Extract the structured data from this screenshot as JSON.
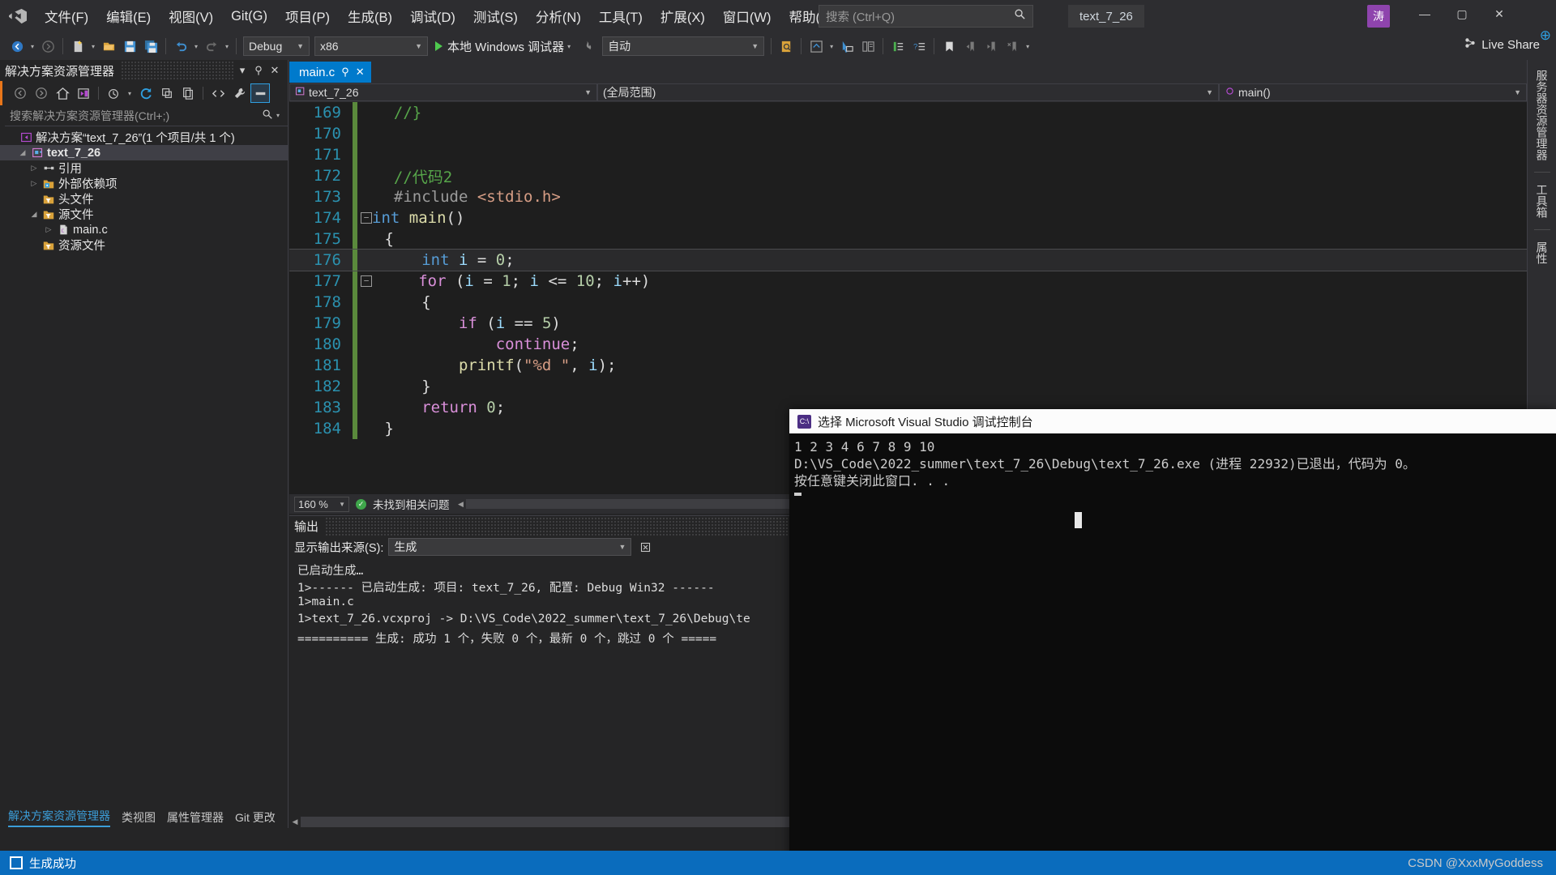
{
  "window": {
    "logo_icon": "visual-studio-logo",
    "project_badge": "text_7_26",
    "avatar_initial": "涛",
    "minimize": "—",
    "maximize": "▢",
    "close": "✕"
  },
  "menu": {
    "items": [
      {
        "label": "文件(F)"
      },
      {
        "label": "编辑(E)"
      },
      {
        "label": "视图(V)"
      },
      {
        "label": "Git(G)"
      },
      {
        "label": "项目(P)"
      },
      {
        "label": "生成(B)"
      },
      {
        "label": "调试(D)"
      },
      {
        "label": "测试(S)"
      },
      {
        "label": "分析(N)"
      },
      {
        "label": "工具(T)"
      },
      {
        "label": "扩展(X)"
      },
      {
        "label": "窗口(W)"
      },
      {
        "label": "帮助(H)"
      }
    ]
  },
  "search": {
    "placeholder": "搜索 (Ctrl+Q)",
    "icon": "search-icon"
  },
  "toolbar": {
    "configuration": "Debug",
    "platform": "x86",
    "run_label": "本地 Windows 调试器",
    "auto_label": "自动",
    "live_share": "Live Share",
    "icons": [
      "navigate-back-icon",
      "navigate-forward-icon",
      "new-file-icon",
      "open-file-icon",
      "save-icon",
      "save-all-icon",
      "undo-icon",
      "redo-icon"
    ]
  },
  "solution_explorer": {
    "title": "解决方案资源管理器",
    "search_placeholder": "搜索解决方案资源管理器(Ctrl+;)",
    "toolbar_icons": [
      "back-icon",
      "forward-icon",
      "home-icon",
      "switch-views-icon",
      "pending-changes-icon",
      "refresh-icon",
      "collapse-all-icon",
      "show-all-files-icon",
      "code-view-icon",
      "properties-wrench-icon",
      "preview-selected-icon"
    ],
    "tree": [
      {
        "label": "解决方案“text_7_26”(1 个项目/共 1 个)",
        "indent": 0,
        "arrow": "",
        "icon": "solution-icon",
        "bold": false,
        "selected": false
      },
      {
        "label": "text_7_26",
        "indent": 1,
        "arrow": "▲",
        "icon": "project-icon",
        "bold": true,
        "selected": true
      },
      {
        "label": "引用",
        "indent": 2,
        "arrow": "▶",
        "icon": "references-icon",
        "bold": false,
        "selected": false
      },
      {
        "label": "外部依赖项",
        "indent": 2,
        "arrow": "▶",
        "icon": "folder-ext-icon",
        "bold": false,
        "selected": false
      },
      {
        "label": "头文件",
        "indent": 2,
        "arrow": "",
        "icon": "folder-header-icon",
        "bold": false,
        "selected": false
      },
      {
        "label": "源文件",
        "indent": 2,
        "arrow": "▲",
        "icon": "folder-source-icon",
        "bold": false,
        "selected": false
      },
      {
        "label": "main.c",
        "indent": 3,
        "arrow": "▶",
        "icon": "c-file-icon",
        "bold": false,
        "selected": false
      },
      {
        "label": "资源文件",
        "indent": 2,
        "arrow": "",
        "icon": "folder-resource-icon",
        "bold": false,
        "selected": false
      }
    ],
    "bottom_tabs": [
      {
        "label": "解决方案资源管理器",
        "active": true
      },
      {
        "label": "类视图",
        "active": false
      },
      {
        "label": "属性管理器",
        "active": false
      },
      {
        "label": "Git 更改",
        "active": false
      }
    ]
  },
  "editor": {
    "tab_label": "main.c",
    "tab_pin_icon": "pin-icon",
    "tab_close_icon": "close-icon",
    "nav_project": "text_7_26",
    "nav_scope": "(全局范围)",
    "nav_member": "main()",
    "zoom_level": "160 %",
    "issue_status": "未找到相关问题",
    "lines": [
      {
        "no": "169",
        "changed": true,
        "fold": "",
        "tokens": [
          {
            "t": "  ",
            "c": "plain"
          },
          {
            "t": "//}",
            "c": "green"
          }
        ]
      },
      {
        "no": "170",
        "changed": true,
        "fold": "",
        "tokens": []
      },
      {
        "no": "171",
        "changed": true,
        "fold": "",
        "tokens": []
      },
      {
        "no": "172",
        "changed": true,
        "fold": "",
        "tokens": [
          {
            "t": "  ",
            "c": "plain"
          },
          {
            "t": "//代码2",
            "c": "green"
          }
        ]
      },
      {
        "no": "173",
        "changed": true,
        "fold": "",
        "tokens": [
          {
            "t": "  ",
            "c": "plain"
          },
          {
            "t": "#include ",
            "c": "pp"
          },
          {
            "t": "<stdio.h>",
            "c": "inc"
          }
        ]
      },
      {
        "no": "174",
        "changed": true,
        "fold": "−",
        "tokens": [
          {
            "t": "int",
            "c": "blue"
          },
          {
            "t": " ",
            "c": "plain"
          },
          {
            "t": "main",
            "c": "fn"
          },
          {
            "t": "()",
            "c": "plain"
          }
        ]
      },
      {
        "no": "175",
        "changed": true,
        "fold": "",
        "tokens": [
          {
            "t": " {",
            "c": "plain"
          }
        ]
      },
      {
        "no": "176",
        "changed": true,
        "fold": "",
        "current": true,
        "tokens": [
          {
            "t": "     ",
            "c": "plain"
          },
          {
            "t": "int",
            "c": "blue"
          },
          {
            "t": " ",
            "c": "plain"
          },
          {
            "t": "i",
            "c": "var"
          },
          {
            "t": " = ",
            "c": "plain"
          },
          {
            "t": "0",
            "c": "num"
          },
          {
            "t": ";",
            "c": "plain"
          }
        ]
      },
      {
        "no": "177",
        "changed": true,
        "fold": "−",
        "tokens": [
          {
            "t": "     ",
            "c": "plain"
          },
          {
            "t": "for",
            "c": "pink"
          },
          {
            "t": " (",
            "c": "plain"
          },
          {
            "t": "i",
            "c": "var"
          },
          {
            "t": " = ",
            "c": "plain"
          },
          {
            "t": "1",
            "c": "num"
          },
          {
            "t": "; ",
            "c": "plain"
          },
          {
            "t": "i",
            "c": "var"
          },
          {
            "t": " <= ",
            "c": "plain"
          },
          {
            "t": "10",
            "c": "num"
          },
          {
            "t": "; ",
            "c": "plain"
          },
          {
            "t": "i",
            "c": "var"
          },
          {
            "t": "++)",
            "c": "plain"
          }
        ]
      },
      {
        "no": "178",
        "changed": true,
        "fold": "",
        "tokens": [
          {
            "t": "     {",
            "c": "plain"
          }
        ]
      },
      {
        "no": "179",
        "changed": true,
        "fold": "",
        "tokens": [
          {
            "t": "         ",
            "c": "plain"
          },
          {
            "t": "if",
            "c": "pink"
          },
          {
            "t": " (",
            "c": "plain"
          },
          {
            "t": "i",
            "c": "var"
          },
          {
            "t": " == ",
            "c": "plain"
          },
          {
            "t": "5",
            "c": "num"
          },
          {
            "t": ")",
            "c": "plain"
          }
        ]
      },
      {
        "no": "180",
        "changed": true,
        "fold": "",
        "tokens": [
          {
            "t": "             ",
            "c": "plain"
          },
          {
            "t": "continue",
            "c": "pink"
          },
          {
            "t": ";",
            "c": "plain"
          }
        ]
      },
      {
        "no": "181",
        "changed": true,
        "fold": "",
        "tokens": [
          {
            "t": "         ",
            "c": "plain"
          },
          {
            "t": "printf",
            "c": "fn"
          },
          {
            "t": "(",
            "c": "plain"
          },
          {
            "t": "\"%d \"",
            "c": "str"
          },
          {
            "t": ", ",
            "c": "plain"
          },
          {
            "t": "i",
            "c": "var"
          },
          {
            "t": ");",
            "c": "plain"
          }
        ]
      },
      {
        "no": "182",
        "changed": true,
        "fold": "",
        "tokens": [
          {
            "t": "     }",
            "c": "plain"
          }
        ]
      },
      {
        "no": "183",
        "changed": true,
        "fold": "",
        "tokens": [
          {
            "t": "     ",
            "c": "plain"
          },
          {
            "t": "return",
            "c": "pink"
          },
          {
            "t": " ",
            "c": "plain"
          },
          {
            "t": "0",
            "c": "num"
          },
          {
            "t": ";",
            "c": "plain"
          }
        ]
      },
      {
        "no": "184",
        "changed": true,
        "fold": "",
        "tokens": [
          {
            "t": " }",
            "c": "plain"
          }
        ]
      }
    ]
  },
  "output_panel": {
    "title": "输出",
    "source_label": "显示输出来源(S):",
    "source_value": "生成",
    "lines": [
      "已启动生成…",
      "1>------ 已启动生成: 项目: text_7_26, 配置: Debug Win32 ------",
      "1>main.c",
      "1>text_7_26.vcxproj -> D:\\VS_Code\\2022_summer\\text_7_26\\Debug\\te",
      "========== 生成: 成功 1 个，失败 0 个，最新 0 个，跳过 0 个 ====="
    ]
  },
  "right_dock": {
    "tabs": [
      "服务器资源管理器",
      "工具箱",
      "属性"
    ]
  },
  "console": {
    "title": "选择 Microsoft Visual Studio 调试控制台",
    "icon": "console-icon",
    "lines": [
      "1 2 3 4 6 7 8 9 10 ",
      "D:\\VS_Code\\2022_summer\\text_7_26\\Debug\\text_7_26.exe (进程 22932)已退出，代码为 0。",
      "按任意键关闭此窗口. . ."
    ]
  },
  "status_bar": {
    "message": "生成成功",
    "icon": "build-success-icon"
  },
  "watermark": "CSDN @XxxMyGoddess",
  "colors": {
    "accent": "#007acc",
    "status_bar": "#0a6cbd",
    "changed_marker": "#5a8a3c",
    "orange_marker": "#e8761a"
  }
}
